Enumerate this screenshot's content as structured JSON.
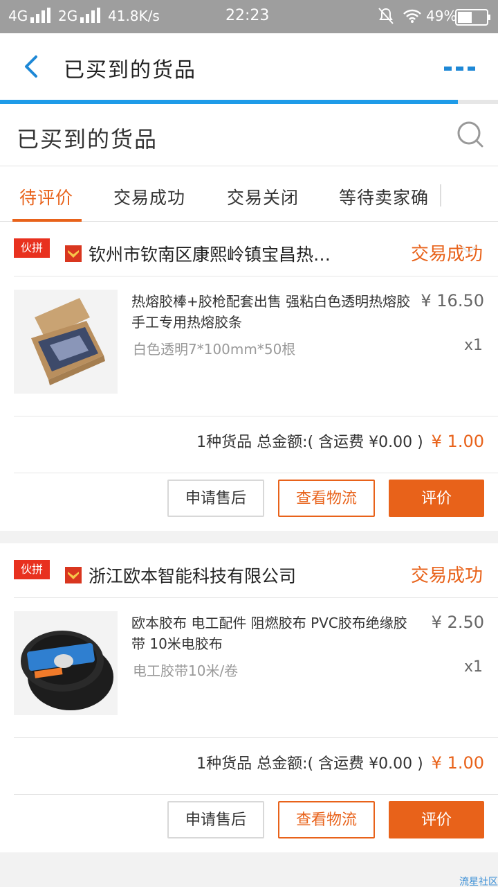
{
  "status_bar": {
    "network1": "4G",
    "network2": "2G",
    "speed": "41.8K/s",
    "time": "22:23",
    "battery": "49%"
  },
  "header": {
    "title": "已买到的货品",
    "progress": 0.92
  },
  "search": {
    "title": "已买到的货品"
  },
  "tabs": [
    {
      "label": "待评价",
      "active": true
    },
    {
      "label": "交易成功",
      "active": false
    },
    {
      "label": "交易关闭",
      "active": false
    },
    {
      "label": "等待卖家确",
      "active": false
    }
  ],
  "orders": [
    {
      "badge": "伙拼",
      "shop": "钦州市钦南区康熙岭镇宝昌热…",
      "status": "交易成功",
      "item_title": "热熔胶棒+胶枪配套出售 强粘白色透明热熔胶 手工专用热熔胶条",
      "spec": "白色透明7*100mm*50根",
      "price": "¥ 16.50",
      "qty": "x1",
      "summary": "1种货品 总金额:( 含运费 ¥0.00 )",
      "total": "¥ 1.00",
      "buttons": {
        "after_sale": "申请售后",
        "logistics": "查看物流",
        "rate": "评价"
      }
    },
    {
      "badge": "伙拼",
      "shop": "浙江欧本智能科技有限公司",
      "status": "交易成功",
      "item_title": "欧本胶布 电工配件 阻燃胶布 PVC胶布绝缘胶带 10米电胶布",
      "spec": "电工胶带10米/卷",
      "price": "¥ 2.50",
      "qty": "x1",
      "summary": "1种货品 总金额:( 含运费 ¥0.00 )",
      "total": "¥ 1.00",
      "buttons": {
        "after_sale": "申请售后",
        "logistics": "查看物流",
        "rate": "评价"
      }
    }
  ],
  "watermark": "流星社区",
  "colors": {
    "accent": "#e8621a",
    "progress": "#1e9be8",
    "badge": "#e8311f",
    "status_bar": "#9e9e9e"
  }
}
